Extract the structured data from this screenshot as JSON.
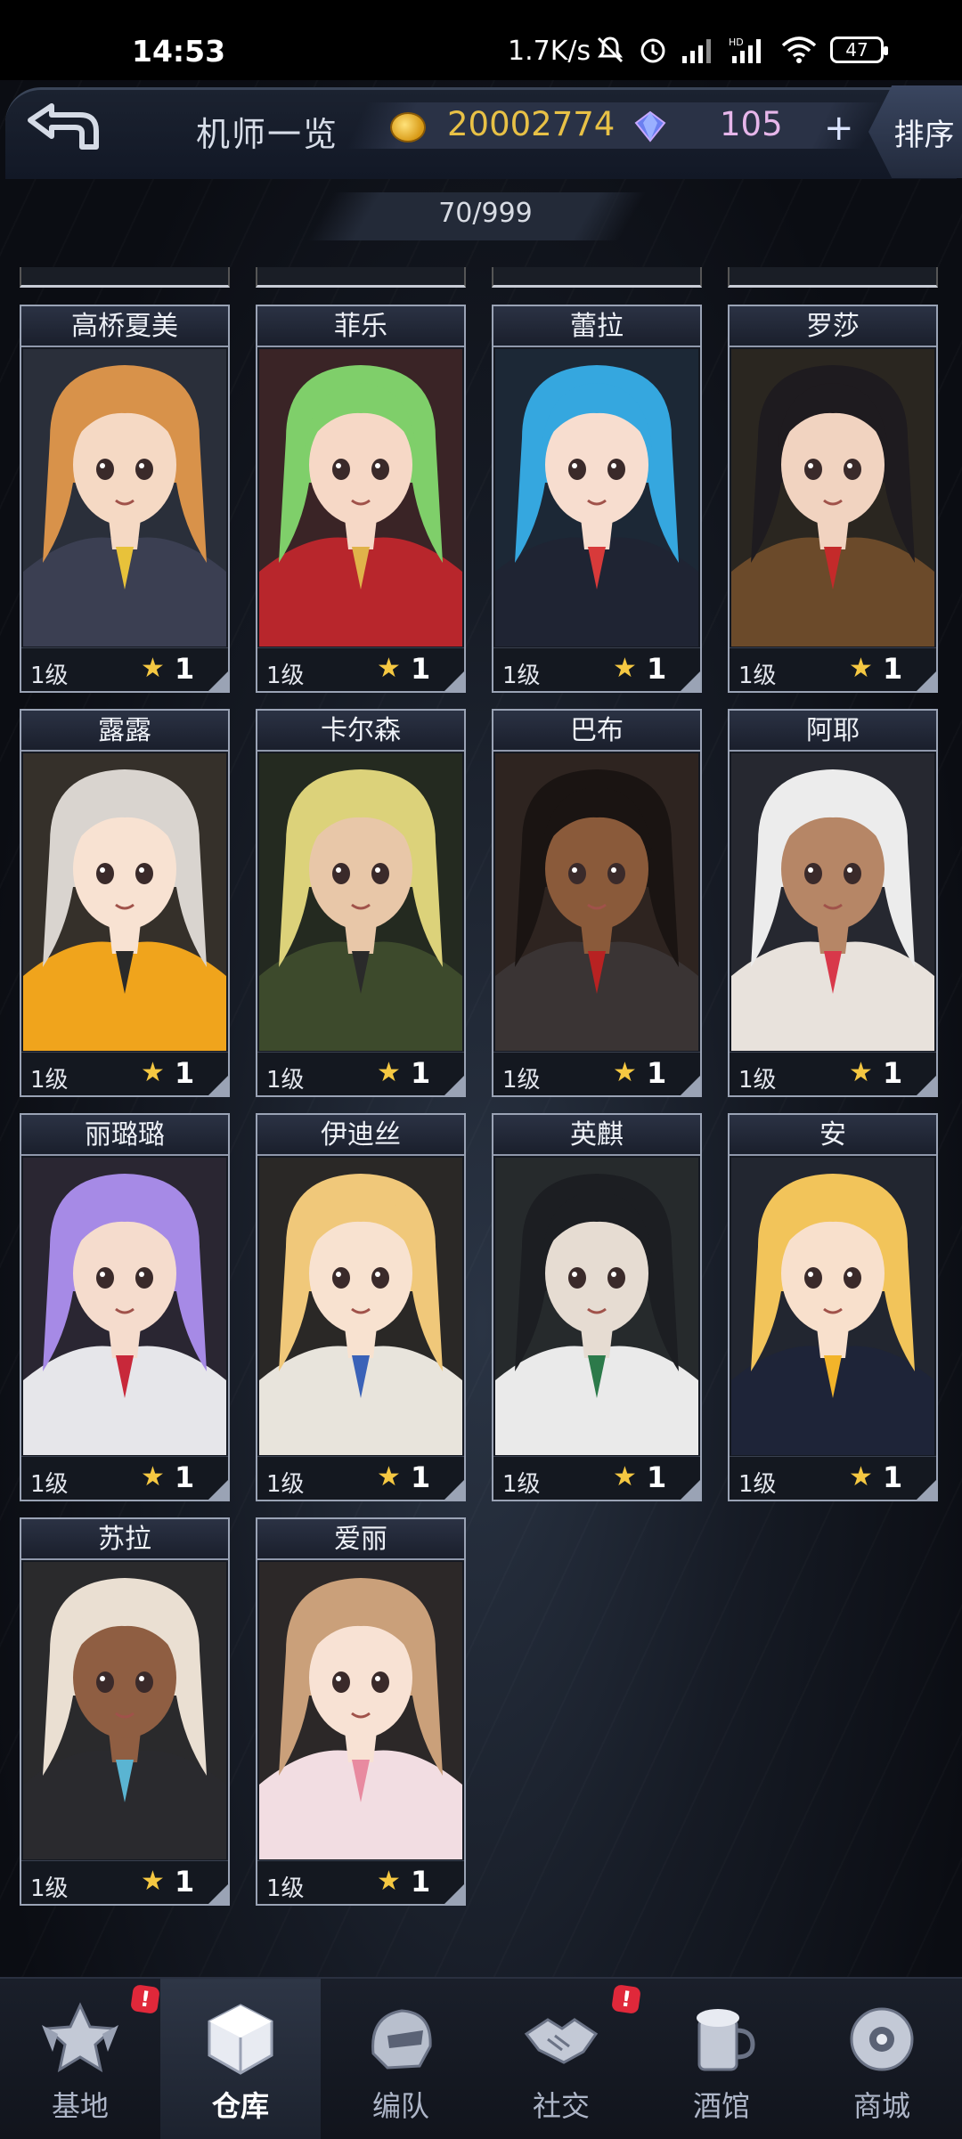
{
  "status_bar": {
    "time": "14:53",
    "network_speed": "1.7K/s",
    "battery": "47"
  },
  "header": {
    "title": "机师一览",
    "coins": "20002774",
    "gems": "105",
    "plus": "+",
    "sort_label": "排序"
  },
  "pilot_count": "70/999",
  "pilots": [
    {
      "name": "高桥夏美",
      "level": "1级",
      "rank": "1",
      "hair": "#d8924a",
      "skin": "#f5d9c4",
      "outfit": "#3b3f52",
      "accent": "#e8c23a",
      "bg": "#2a2f3a"
    },
    {
      "name": "菲乐",
      "level": "1级",
      "rank": "1",
      "hair": "#7fcf6a",
      "skin": "#f6d8c6",
      "outfit": "#b8262c",
      "accent": "#e0b34a",
      "bg": "#3a2426"
    },
    {
      "name": "蕾拉",
      "level": "1级",
      "rank": "1",
      "hair": "#35a7df",
      "skin": "#f7ddcf",
      "outfit": "#1f2433",
      "accent": "#d83a3a",
      "bg": "#1c2836"
    },
    {
      "name": "罗莎",
      "level": "1级",
      "rank": "1",
      "hair": "#1e1b1f",
      "skin": "#f1d3c0",
      "outfit": "#6b4a2a",
      "accent": "#c42a2a",
      "bg": "#2a2620"
    },
    {
      "name": "露露",
      "level": "1级",
      "rank": "1",
      "hair": "#d9d4cf",
      "skin": "#f8e2d2",
      "outfit": "#f0a41c",
      "accent": "#2a2a2a",
      "bg": "#35302a"
    },
    {
      "name": "卡尔森",
      "level": "1级",
      "rank": "1",
      "hair": "#dcd27a",
      "skin": "#e8c7a8",
      "outfit": "#3d4a2c",
      "accent": "#2a2a2a",
      "bg": "#242a20"
    },
    {
      "name": "巴布",
      "level": "1级",
      "rank": "1",
      "hair": "#1a1412",
      "skin": "#8a5a3a",
      "outfit": "#3a3434",
      "accent": "#b82222",
      "bg": "#2e2420"
    },
    {
      "name": "阿耶",
      "level": "1级",
      "rank": "1",
      "hair": "#ececec",
      "skin": "#b68666",
      "outfit": "#e8e2dc",
      "accent": "#d8384a",
      "bg": "#262830"
    },
    {
      "name": "丽璐璐",
      "level": "1级",
      "rank": "1",
      "hair": "#a68ae6",
      "skin": "#f5dccd",
      "outfit": "#e6e6ea",
      "accent": "#c8283a",
      "bg": "#2a2632"
    },
    {
      "name": "伊迪丝",
      "level": "1级",
      "rank": "1",
      "hair": "#f0c87a",
      "skin": "#f8e2d0",
      "outfit": "#e8e4dc",
      "accent": "#3a62b8",
      "bg": "#2a2826"
    },
    {
      "name": "英麒",
      "level": "1级",
      "rank": "1",
      "hair": "#1c1e22",
      "skin": "#e6dcd2",
      "outfit": "#eaeaea",
      "accent": "#2c7a4a",
      "bg": "#262a2c"
    },
    {
      "name": "安",
      "level": "1级",
      "rank": "1",
      "hair": "#f2c45a",
      "skin": "#f8e0cc",
      "outfit": "#1e2438",
      "accent": "#f2b42a",
      "bg": "#222630"
    },
    {
      "name": "苏拉",
      "level": "1级",
      "rank": "1",
      "hair": "#eadfd2",
      "skin": "#8f5e42",
      "outfit": "#2a2a2e",
      "accent": "#5ab4d2",
      "bg": "#2a2a2c"
    },
    {
      "name": "爱丽",
      "level": "1级",
      "rank": "1",
      "hair": "#caa07a",
      "skin": "#f8e2d4",
      "outfit": "#f2dde2",
      "accent": "#e88aa0",
      "bg": "#2c2828"
    }
  ],
  "nav": [
    {
      "label": "基地",
      "badge": "!",
      "icon": "base-emblem-icon"
    },
    {
      "label": "仓库",
      "badge": "",
      "icon": "warehouse-cube-icon"
    },
    {
      "label": "编队",
      "badge": "",
      "icon": "squad-helmet-icon"
    },
    {
      "label": "社交",
      "badge": "!",
      "icon": "handshake-icon"
    },
    {
      "label": "酒馆",
      "badge": "",
      "icon": "tavern-mug-icon"
    },
    {
      "label": "商城",
      "badge": "",
      "icon": "shop-robot-icon"
    }
  ],
  "active_nav": "仓库"
}
